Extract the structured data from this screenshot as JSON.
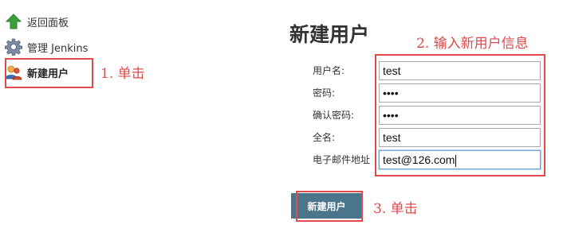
{
  "sidebar": {
    "items": [
      {
        "label": "返回面板",
        "icon": "up-arrow-icon"
      },
      {
        "label": "管理 Jenkins",
        "icon": "gear-icon"
      },
      {
        "label": "新建用户",
        "icon": "users-icon"
      }
    ]
  },
  "annotations": {
    "step1": "1. 单击",
    "step2": "2. 输入新用户信息",
    "step3": "3. 单击",
    "color": "#e04a4a"
  },
  "main": {
    "title": "新建用户",
    "fields": [
      {
        "label": "用户名:",
        "value": "test"
      },
      {
        "label": "密码:",
        "value": "••••"
      },
      {
        "label": "确认密码:",
        "value": "••••"
      },
      {
        "label": "全名:",
        "value": "test"
      },
      {
        "label": "电子邮件地址",
        "value": "test@126.com"
      }
    ],
    "submit_label": "新建用户"
  },
  "colors": {
    "button_bg": "#4b758b",
    "accent": "#e04a4a"
  }
}
